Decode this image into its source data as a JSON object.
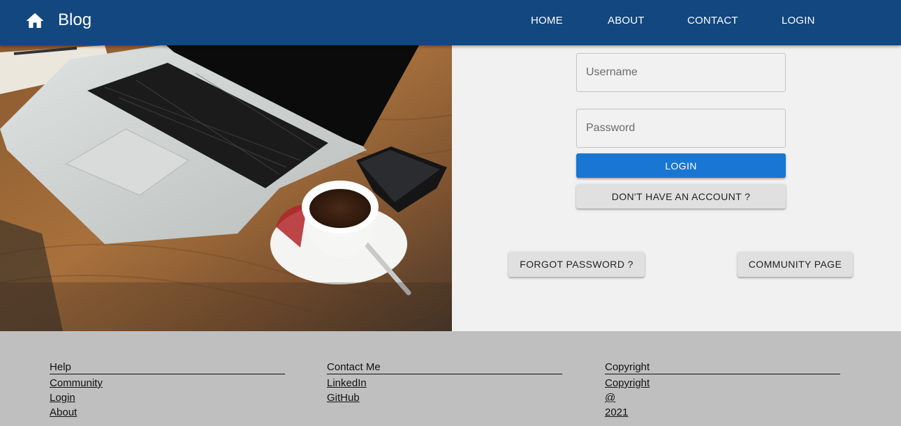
{
  "header": {
    "brand": "Blog",
    "home_icon": "home-icon",
    "nav": {
      "home": "HOME",
      "about": "ABOUT",
      "contact": "CONTACT",
      "login": "LOGIN"
    },
    "background_color": "#12477f"
  },
  "login_form": {
    "username_placeholder": "Username",
    "username_value": "",
    "password_placeholder": "Password",
    "password_value": "",
    "login_label": "LOGIN",
    "signup_label": "DON'T HAVE AN ACCOUNT ?",
    "forgot_label": "FORGOT PASSWORD ?",
    "community_label": "COMMUNITY PAGE",
    "primary_color": "#1976d2"
  },
  "footer": {
    "columns": [
      {
        "heading": "Help",
        "links": [
          "Community",
          "Login",
          "About"
        ]
      },
      {
        "heading": "Contact Me",
        "links": [
          "LinkedIn",
          "GitHub"
        ]
      },
      {
        "heading": "Copyright",
        "links": [
          "Copyright",
          "@",
          "2021"
        ]
      }
    ],
    "background_color": "#bfbfbf"
  }
}
